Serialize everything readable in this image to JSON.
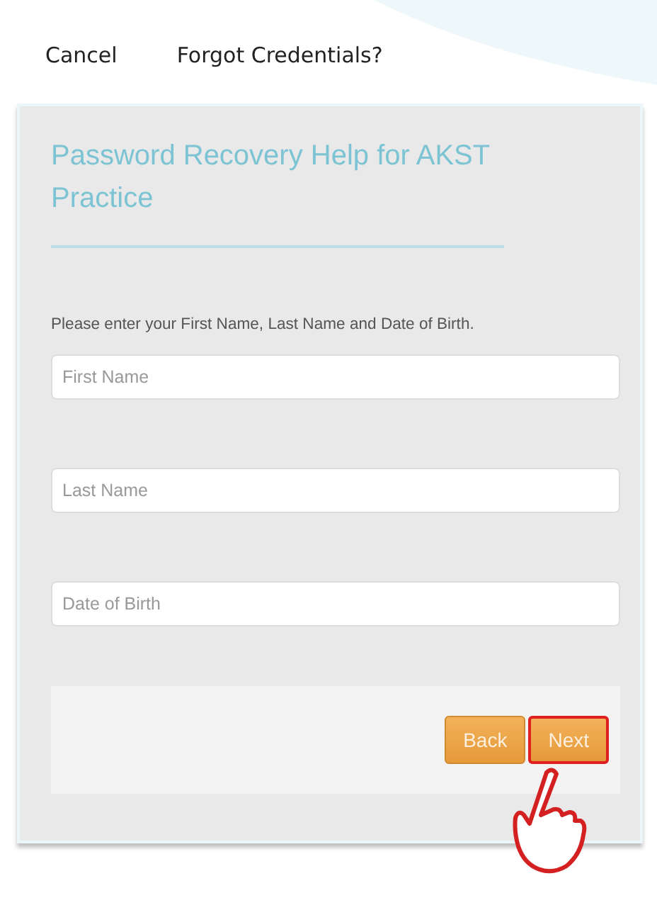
{
  "header": {
    "cancel": "Cancel",
    "title": "Forgot Credentials?"
  },
  "panel": {
    "heading": "Password Recovery Help for AKST Practice",
    "instruction": "Please enter your First Name, Last Name and Date of Birth.",
    "fields": [
      {
        "placeholder": "First Name"
      },
      {
        "placeholder": "Last Name"
      },
      {
        "placeholder": "Date of Birth"
      }
    ],
    "buttons": [
      {
        "label": "Back",
        "highlighted": false
      },
      {
        "label": "Next",
        "highlighted": true
      }
    ]
  }
}
